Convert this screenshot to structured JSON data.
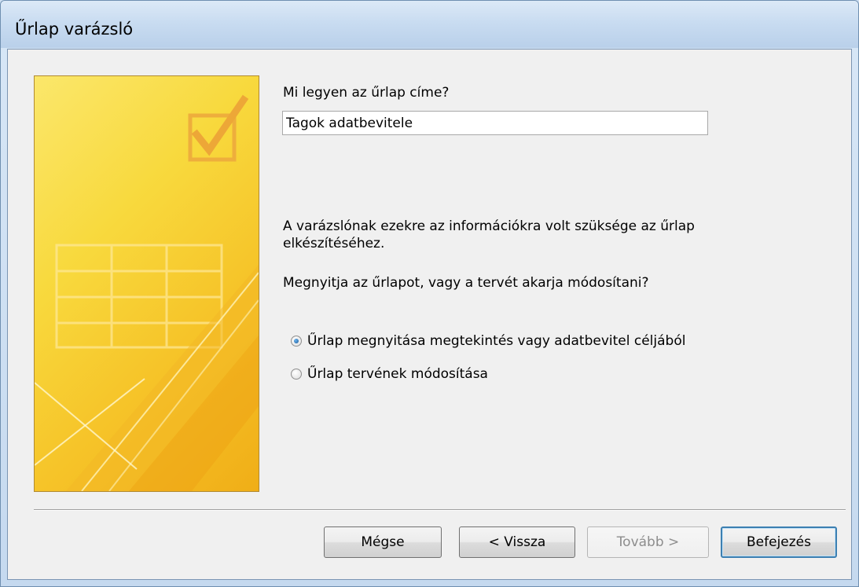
{
  "window": {
    "title": "Űrlap varázsló"
  },
  "form_title": {
    "question": "Mi legyen az űrlap címe?",
    "value": "Tagok adatbevitele"
  },
  "info": {
    "message": "A varázslónak ezekre az információkra volt szüksége az űrlap elkészítéséhez.",
    "prompt": "Megnyitja az űrlapot, vagy a tervét akarja módosítani?"
  },
  "options": [
    {
      "label": "Űrlap megnyitása megtekintés vagy adatbevitel céljából",
      "checked": true
    },
    {
      "label": "Űrlap tervének módosítása",
      "checked": false
    }
  ],
  "buttons": {
    "cancel": "Mégse",
    "back": "< Vissza",
    "next": "Tovább >",
    "finish": "Befejezés"
  },
  "colors": {
    "panel_yellow": "#f8d93d",
    "default_button_border": "#3c7fb1"
  }
}
